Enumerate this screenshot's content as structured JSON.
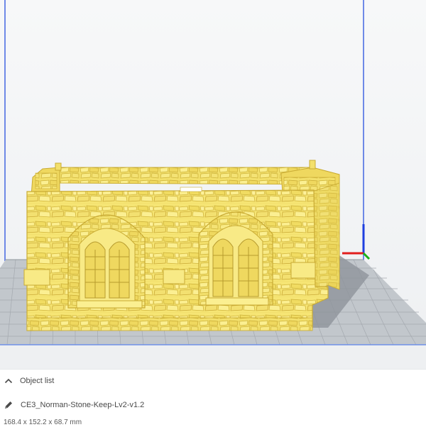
{
  "viewport": {
    "background_color": "#f6f7f8",
    "build_plate_color": "#c2c7cc",
    "grid_line_color": "#9aa0a6",
    "model_color": "#f6e574",
    "model_edge_color": "#d1b43a",
    "shadow_color": "#8f949b",
    "axes": {
      "x_color": "#e11d1d",
      "y_color": "#19b019",
      "z_color": "#1e3fe0"
    },
    "build_volume_edge_color": "#4d6ee3"
  },
  "object_panel": {
    "header_label": "Object list",
    "header_icon": "chevron-up-icon",
    "edit_icon": "pencil-icon",
    "object_name": "CE3_Norman-Stone-Keep-Lv2-v1.2",
    "dimensions": "168.4 x 152.2 x 68.7 mm"
  }
}
